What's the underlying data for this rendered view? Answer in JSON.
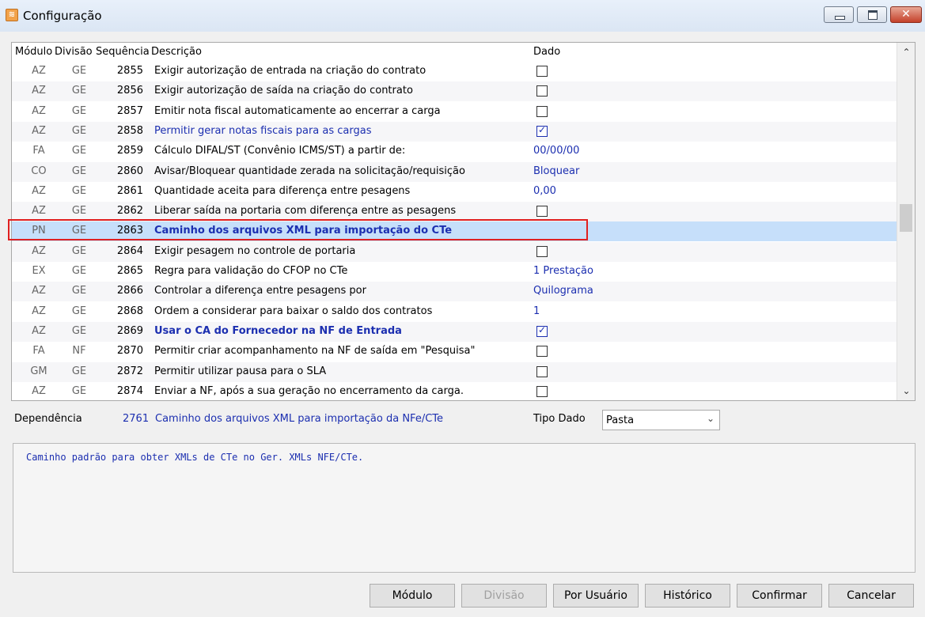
{
  "window": {
    "title": "Configuração",
    "icon": "app-logo-icon",
    "close_glyph": "✕"
  },
  "columns": {
    "modulo": "Módulo",
    "divisao": "Divisão",
    "sequencia": "Sequência",
    "descricao": "Descrição",
    "dado": "Dado"
  },
  "rows": [
    {
      "mod": "AZ",
      "div": "GE",
      "seq": "2855",
      "desc": "Exigir autorização de entrada na criação do contrato",
      "val_type": "checkbox",
      "checked": false,
      "val": ""
    },
    {
      "mod": "AZ",
      "div": "GE",
      "seq": "2856",
      "desc": "Exigir autorização de saída na criação do contrato",
      "val_type": "checkbox",
      "checked": false,
      "val": ""
    },
    {
      "mod": "AZ",
      "div": "GE",
      "seq": "2857",
      "desc": "Emitir nota fiscal automaticamente ao encerrar a carga",
      "val_type": "checkbox",
      "checked": false,
      "val": ""
    },
    {
      "mod": "AZ",
      "div": "GE",
      "seq": "2858",
      "desc": "Permitir gerar notas fiscais para as cargas",
      "val_type": "checkbox",
      "checked": true,
      "val": "",
      "style": "blue"
    },
    {
      "mod": "FA",
      "div": "GE",
      "seq": "2859",
      "desc": "Cálculo DIFAL/ST (Convênio ICMS/ST) a partir de:",
      "val_type": "text",
      "val": "00/00/00"
    },
    {
      "mod": "CO",
      "div": "GE",
      "seq": "2860",
      "desc": "Avisar/Bloquear quantidade zerada na solicitação/requisição",
      "val_type": "text",
      "val": "Bloquear"
    },
    {
      "mod": "AZ",
      "div": "GE",
      "seq": "2861",
      "desc": "Quantidade aceita para diferença entre pesagens",
      "val_type": "text",
      "val": "0,00"
    },
    {
      "mod": "AZ",
      "div": "GE",
      "seq": "2862",
      "desc": "Liberar saída na portaria com diferença entre as pesagens",
      "val_type": "checkbox",
      "checked": false,
      "val": ""
    },
    {
      "mod": "PN",
      "div": "GE",
      "seq": "2863",
      "desc": "Caminho dos arquivos XML para importação do CTe",
      "val_type": "none",
      "val": "",
      "style": "bold",
      "selected": true
    },
    {
      "mod": "AZ",
      "div": "GE",
      "seq": "2864",
      "desc": "Exigir pesagem no controle de portaria",
      "val_type": "checkbox",
      "checked": false,
      "val": ""
    },
    {
      "mod": "EX",
      "div": "GE",
      "seq": "2865",
      "desc": "Regra para validação do CFOP no CTe",
      "val_type": "text",
      "val": "1 Prestação"
    },
    {
      "mod": "AZ",
      "div": "GE",
      "seq": "2866",
      "desc": "Controlar a diferença entre pesagens por",
      "val_type": "text",
      "val": "Quilograma"
    },
    {
      "mod": "AZ",
      "div": "GE",
      "seq": "2868",
      "desc": "Ordem a considerar para baixar o saldo dos contratos",
      "val_type": "text",
      "val": "1"
    },
    {
      "mod": "AZ",
      "div": "GE",
      "seq": "2869",
      "desc": "Usar o CA do Fornecedor na NF de Entrada",
      "val_type": "checkbox",
      "checked": true,
      "val": "",
      "style": "bold"
    },
    {
      "mod": "FA",
      "div": "NF",
      "seq": "2870",
      "desc": "Permitir criar acompanhamento na NF de saída em \"Pesquisa\"",
      "val_type": "checkbox",
      "checked": false,
      "val": ""
    },
    {
      "mod": "GM",
      "div": "GE",
      "seq": "2872",
      "desc": "Permitir utilizar pausa para o SLA",
      "val_type": "checkbox",
      "checked": false,
      "val": ""
    },
    {
      "mod": "AZ",
      "div": "GE",
      "seq": "2874",
      "desc": "Enviar a NF, após a sua geração no encerramento da carga.",
      "val_type": "checkbox",
      "checked": false,
      "val": ""
    }
  ],
  "dependency": {
    "label": "Dependência",
    "seq": "2761",
    "desc": "Caminho dos arquivos XML para importação da NFe/CTe"
  },
  "tipo_dado": {
    "label": "Tipo Dado",
    "value": "Pasta"
  },
  "memo": "Caminho padrão para obter XMLs de CTe no Ger. XMLs NFE/CTe.",
  "buttons": {
    "modulo": "Módulo",
    "divisao": "Divisão",
    "por_usuario": "Por Usuário",
    "historico": "Histórico",
    "confirmar": "Confirmar",
    "cancelar": "Cancelar"
  },
  "colors": {
    "accent_text": "#1c2fb0",
    "selected_row": "#c6dffa",
    "highlight_border": "#e02020"
  }
}
